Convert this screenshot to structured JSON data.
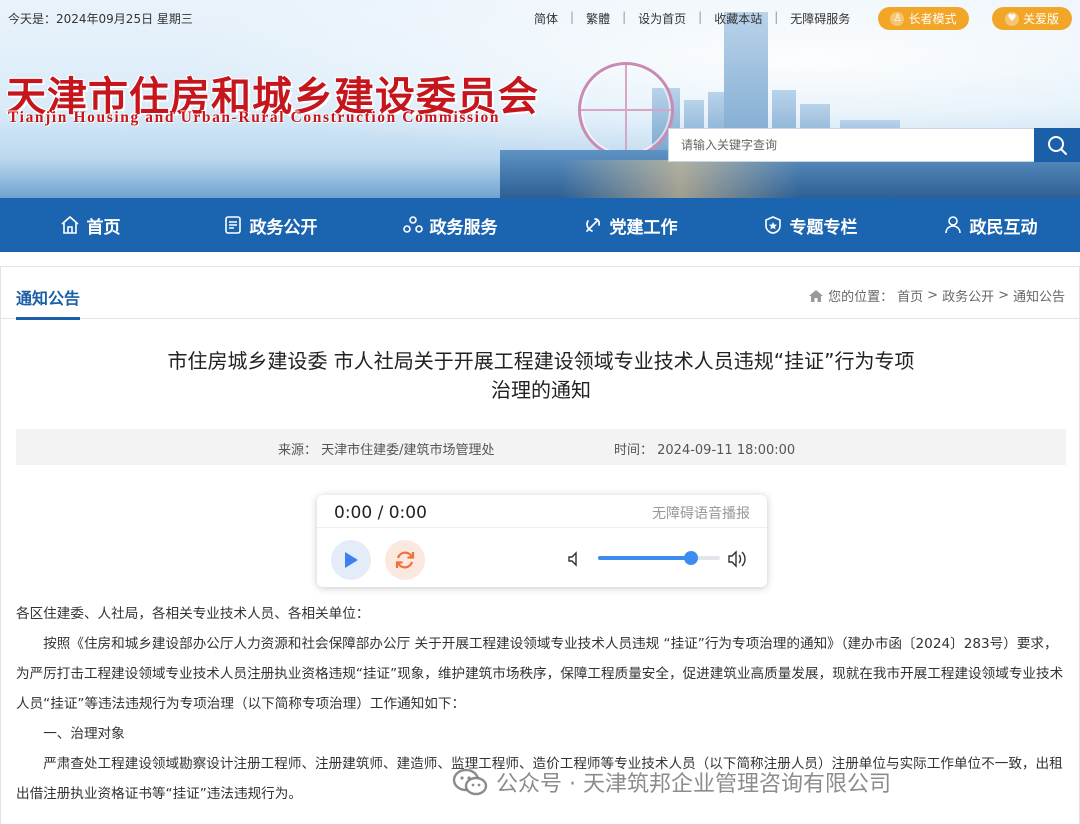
{
  "topbar": {
    "date": "今天是：2024年09月25日 星期三",
    "links": [
      "简体",
      "繁體",
      "设为首页",
      "收藏本站",
      "无障碍服务"
    ],
    "elder_mode": "长者模式",
    "care_version": "关爱版"
  },
  "logo": {
    "cn": "天津市住房和城乡建设委员会",
    "en": "Tianjin Housing and Urban-Rural Construction Commission"
  },
  "search": {
    "placeholder": "请输入关键字查询"
  },
  "nav": [
    {
      "label": "首页",
      "icon": "home-icon"
    },
    {
      "label": "政务公开",
      "icon": "document-icon"
    },
    {
      "label": "政务服务",
      "icon": "service-icon"
    },
    {
      "label": "党建工作",
      "icon": "party-icon"
    },
    {
      "label": "专题专栏",
      "icon": "badge-icon"
    },
    {
      "label": "政民互动",
      "icon": "user-icon"
    }
  ],
  "section": {
    "title": "通知公告",
    "breadcrumb_prefix": "您的位置：",
    "breadcrumb": [
      "首页",
      "政务公开",
      "通知公告"
    ],
    "breadcrumb_sep": ">"
  },
  "article": {
    "title_line1": "市住房城乡建设委 市人社局关于开展工程建设领域专业技术人员违规“挂证”行为专项",
    "title_line2": "治理的通知",
    "source": "来源： 天津市住建委/建筑市场管理处",
    "time": "时间： 2024-09-11 18:00:00",
    "paragraphs": [
      "各区住建委、人社局，各相关专业技术人员、各相关单位：",
      "按照《住房和城乡建设部办公厅人力资源和社会保障部办公厅 关于开展工程建设领域专业技术人员违规 “挂证”行为专项治理的通知》（建办市函〔2024〕283号）要求，为严厉打击工程建设领域专业技术人员注册执业资格违规“挂证”现象，维护建筑市场秩序，保障工程质量安全，促进建筑业高质量发展，现就在我市开展工程建设领域专业技术人员“挂证”等违法违规行为专项治理（以下简称专项治理）工作通知如下：",
      "一、治理对象",
      "严肃查处工程建设领域勘察设计注册工程师、注册建筑师、建造师、监理工程师、造价工程师等专业技术人员（以下简称注册人员）注册单位与实际工作单位不一致，出租出借注册执业资格证书等“挂证”违法违规行为。"
    ]
  },
  "player": {
    "time": "0:00 / 0:00",
    "label": "无障碍语音播报",
    "volume": 0.76
  },
  "watermark": {
    "text": "公众号 · 天津筑邦企业管理咨询有限公司"
  },
  "colors": {
    "nav_bg": "#1b64b0",
    "accent": "#1a5fa8",
    "logo_red": "#c4161c",
    "mode_btn": "#f2a627"
  }
}
